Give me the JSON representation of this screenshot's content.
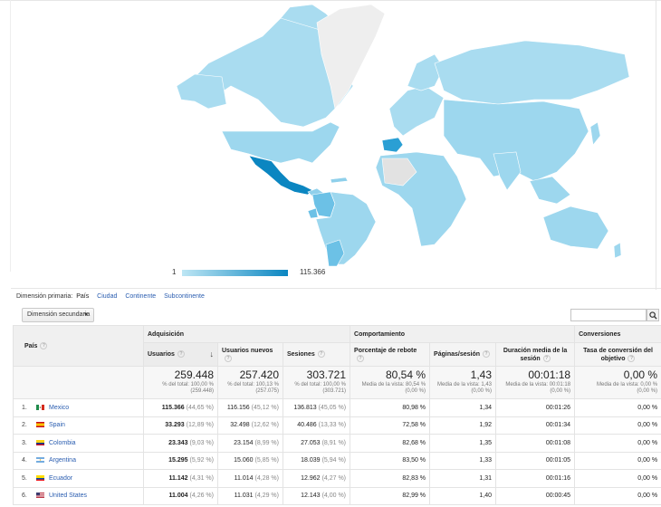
{
  "legend": {
    "min": "1",
    "max": "115.366"
  },
  "dimensions": {
    "label": "Dimensión primaria:",
    "current": "País",
    "links": [
      "Ciudad",
      "Continente",
      "Subcontinente"
    ]
  },
  "secondary_dimension": "Dimensión secundaria",
  "table": {
    "country_header": "País",
    "groups": {
      "acquisition": "Adquisición",
      "behaviour": "Comportamiento",
      "conversions": "Conversiones"
    },
    "columns": {
      "users": "Usuarios",
      "new_users": "Usuarios nuevos",
      "sessions": "Sesiones",
      "bounce": "Porcentaje de rebote",
      "pages": "Páginas/sesión",
      "duration": "Duración media de la sesión",
      "conversion": "Tasa de conversión del objetivo"
    },
    "totals": {
      "users": "259.448",
      "users_sub1": "% del total: 100,00 %",
      "users_sub2": "(259.448)",
      "new_users": "257.420",
      "new_users_sub1": "% del total: 100,13 %",
      "new_users_sub2": "(257.075)",
      "sessions": "303.721",
      "sessions_sub1": "% del total: 100,00 %",
      "sessions_sub2": "(303.721)",
      "bounce": "80,54 %",
      "bounce_sub1": "Media de la vista: 80,54 %",
      "bounce_sub2": "(0,00 %)",
      "pages": "1,43",
      "pages_sub1": "Media de la vista: 1,43",
      "pages_sub2": "(0,00 %)",
      "duration": "00:01:18",
      "duration_sub1": "Media de la vista: 00:01:18",
      "duration_sub2": "(0,00 %)",
      "conversion": "0,00 %",
      "conversion_sub1": "Media de la vista: 0,00 %",
      "conversion_sub2": "(0,00 %)"
    },
    "rows": [
      {
        "n": "1.",
        "country": "Mexico",
        "users": "115.366",
        "users_pct": "(44,65 %)",
        "new_users": "116.156",
        "new_users_pct": "(45,12 %)",
        "sessions": "136.813",
        "sessions_pct": "(45,05 %)",
        "bounce": "80,98 %",
        "pages": "1,34",
        "duration": "00:01:26",
        "conversion": "0,00 %"
      },
      {
        "n": "2.",
        "country": "Spain",
        "users": "33.293",
        "users_pct": "(12,89 %)",
        "new_users": "32.498",
        "new_users_pct": "(12,62 %)",
        "sessions": "40.486",
        "sessions_pct": "(13,33 %)",
        "bounce": "72,58 %",
        "pages": "1,92",
        "duration": "00:01:34",
        "conversion": "0,00 %"
      },
      {
        "n": "3.",
        "country": "Colombia",
        "users": "23.343",
        "users_pct": "(9,03 %)",
        "new_users": "23.154",
        "new_users_pct": "(8,99 %)",
        "sessions": "27.053",
        "sessions_pct": "(8,91 %)",
        "bounce": "82,68 %",
        "pages": "1,35",
        "duration": "00:01:08",
        "conversion": "0,00 %"
      },
      {
        "n": "4.",
        "country": "Argentina",
        "users": "15.295",
        "users_pct": "(5,92 %)",
        "new_users": "15.060",
        "new_users_pct": "(5,85 %)",
        "sessions": "18.039",
        "sessions_pct": "(5,94 %)",
        "bounce": "83,50 %",
        "pages": "1,33",
        "duration": "00:01:05",
        "conversion": "0,00 %"
      },
      {
        "n": "5.",
        "country": "Ecuador",
        "users": "11.142",
        "users_pct": "(4,31 %)",
        "new_users": "11.014",
        "new_users_pct": "(4,28 %)",
        "sessions": "12.962",
        "sessions_pct": "(4,27 %)",
        "bounce": "82,83 %",
        "pages": "1,31",
        "duration": "00:01:16",
        "conversion": "0,00 %"
      },
      {
        "n": "6.",
        "country": "United States",
        "users": "11.004",
        "users_pct": "(4,26 %)",
        "new_users": "11.031",
        "new_users_pct": "(4,29 %)",
        "sessions": "12.143",
        "sessions_pct": "(4,00 %)",
        "bounce": "82,99 %",
        "pages": "1,40",
        "duration": "00:00:45",
        "conversion": "0,00 %"
      }
    ]
  }
}
